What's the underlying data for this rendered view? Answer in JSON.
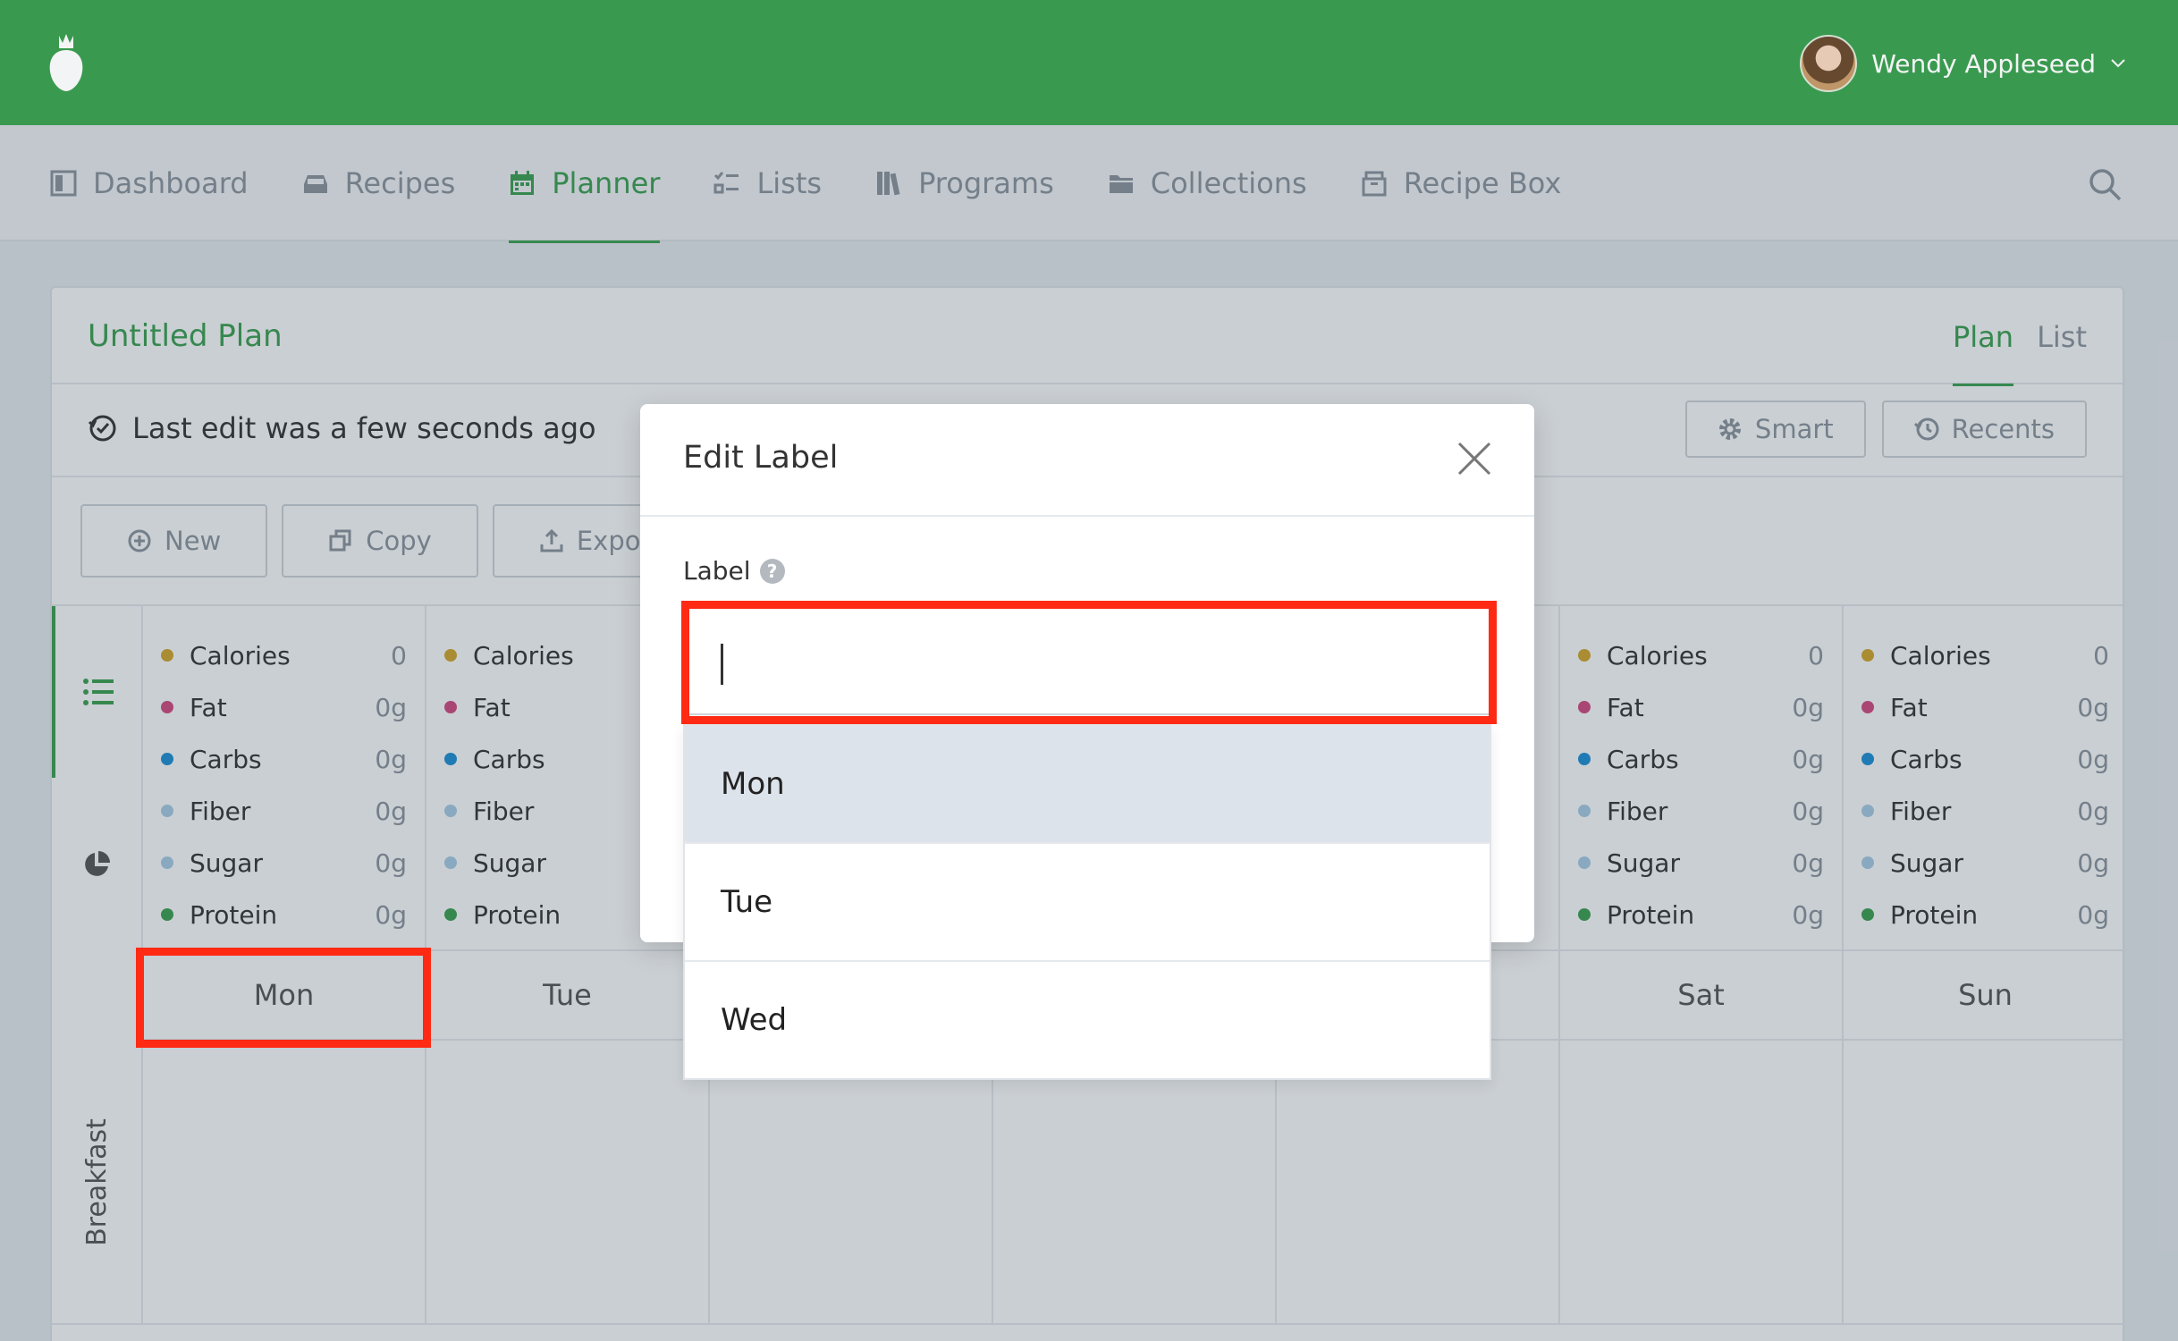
{
  "header": {
    "user_name": "Wendy Appleseed",
    "icons": {
      "logo": "strawberry-logo-icon",
      "user_menu": "chevron-down-icon"
    }
  },
  "nav": {
    "items": [
      {
        "label": "Dashboard",
        "icon": "dashboard-icon"
      },
      {
        "label": "Recipes",
        "icon": "recipes-icon"
      },
      {
        "label": "Planner",
        "icon": "calendar-icon"
      },
      {
        "label": "Lists",
        "icon": "checklist-icon"
      },
      {
        "label": "Programs",
        "icon": "programs-icon"
      },
      {
        "label": "Collections",
        "icon": "folder-icon"
      },
      {
        "label": "Recipe Box",
        "icon": "recipe-box-icon"
      }
    ],
    "active": "Planner",
    "search_icon": "search-icon"
  },
  "plan": {
    "title": "Untitled Plan",
    "view_tabs": [
      "Plan",
      "List"
    ],
    "active_view": "Plan",
    "last_edit": "Last edit was a few seconds ago",
    "smart_label": "Smart",
    "recents_label": "Recents",
    "new_label": "New",
    "copy_label": "Copy",
    "export_label": "Expor"
  },
  "nutrients": [
    "Calories",
    "Fat",
    "Carbs",
    "Fiber",
    "Sugar",
    "Protein"
  ],
  "nutrient_colors": [
    "#d4a62a",
    "#d4487f",
    "#1d8fd6",
    "#a9cde6",
    "#a9cde6",
    "#3aa04f"
  ],
  "days": [
    {
      "label": "Mon",
      "values": [
        "0",
        "0g",
        "0g",
        "0g",
        "0g",
        "0g"
      ]
    },
    {
      "label": "Tue",
      "values": [
        "",
        "",
        "",
        "",
        "",
        ""
      ]
    },
    {
      "label": "",
      "values": [
        "",
        "",
        "",
        "",
        "",
        ""
      ]
    },
    {
      "label": "",
      "values": [
        "",
        "",
        "",
        "",
        "",
        ""
      ]
    },
    {
      "label": "",
      "values": [
        "",
        "",
        "",
        "",
        "",
        ""
      ]
    },
    {
      "label": "Sat",
      "values": [
        "0",
        "0g",
        "0g",
        "0g",
        "0g",
        "0g"
      ]
    },
    {
      "label": "Sun",
      "values": [
        "0",
        "0g",
        "0g",
        "0g",
        "0g",
        "0g"
      ]
    }
  ],
  "meals": [
    "Breakfast"
  ],
  "modal": {
    "title": "Edit Label",
    "field_label": "Label",
    "input_value": "",
    "options": [
      "Mon",
      "Tue",
      "Wed"
    ],
    "highlighted_option": "Mon"
  },
  "colors": {
    "brand": "#3aa04f",
    "highlight": "#ff2a14"
  }
}
